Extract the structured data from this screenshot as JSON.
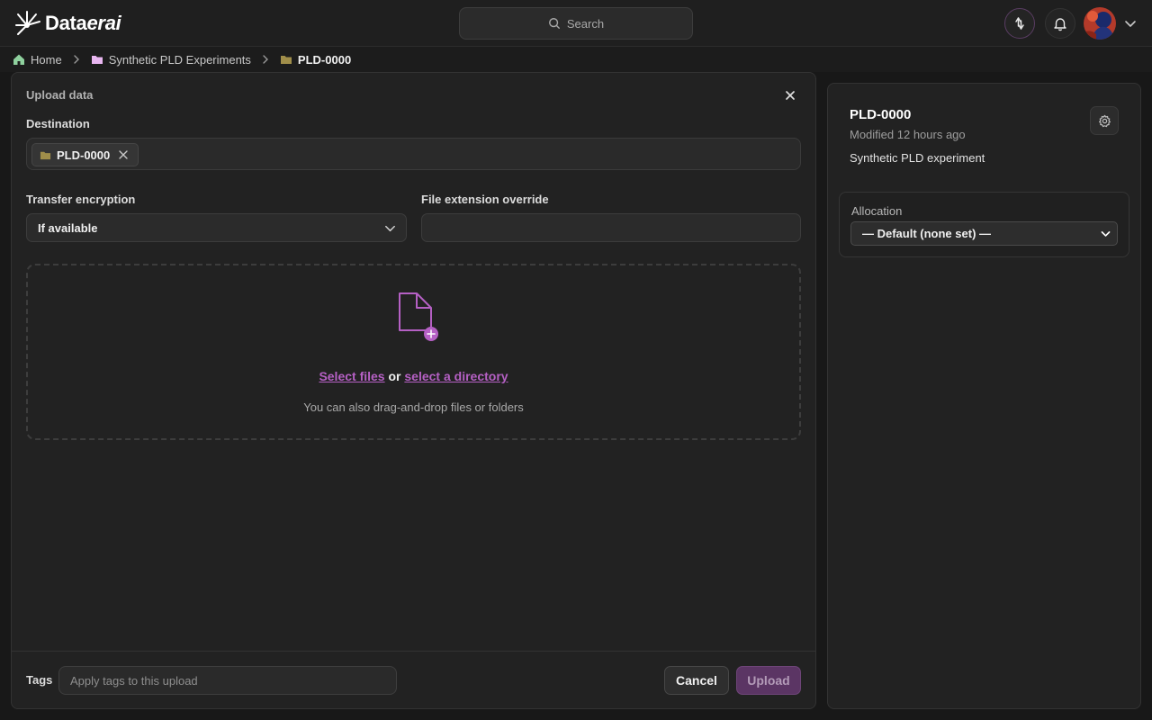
{
  "app": {
    "logo_text_regular": "Data",
    "logo_text_italic": "erai",
    "search_placeholder": "Search"
  },
  "breadcrumb": {
    "items": [
      {
        "label": "Home",
        "icon": "home-icon"
      },
      {
        "label": "Synthetic PLD Experiments",
        "icon": "folder-icon"
      },
      {
        "label": "PLD-0000",
        "icon": "folder-icon"
      }
    ]
  },
  "upload": {
    "title": "Upload data",
    "destination_label": "Destination",
    "destination_chip": "PLD-0000",
    "encryption_label": "Transfer encryption",
    "encryption_value": "If available",
    "extension_label": "File extension override",
    "extension_value": "",
    "select_files": "Select files",
    "or_text": "or",
    "select_directory": "select a directory",
    "drop_hint": "You can also drag-and-drop files or folders",
    "tags_label": "Tags",
    "tags_placeholder": "Apply tags to this upload",
    "cancel_label": "Cancel",
    "upload_label": "Upload"
  },
  "info": {
    "title": "PLD-0000",
    "modified": "Modified 12 hours ago",
    "description": "Synthetic PLD experiment",
    "allocation_label": "Allocation",
    "allocation_value": "— Default (none set) —"
  },
  "colors": {
    "accent": "#b560c4",
    "upload_button": "#5b3564",
    "folder_purple": "#e8b6f0",
    "folder_olive": "#a08e4a",
    "home_green": "#8fd19e"
  }
}
